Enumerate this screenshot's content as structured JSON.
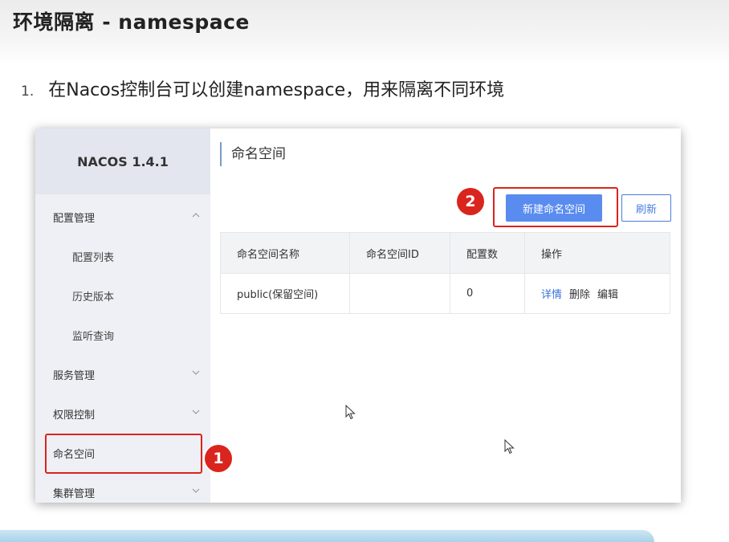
{
  "slide": {
    "title": "环境隔离 - namespace",
    "step_number": "1.",
    "step_text": "在Nacos控制台可以创建namespace，用来隔离不同环境"
  },
  "console": {
    "logo": "NACOS 1.4.1",
    "menu": [
      {
        "label": "配置管理",
        "chevron": "chevron-up-icon"
      },
      {
        "label": "配置列表"
      },
      {
        "label": "历史版本"
      },
      {
        "label": "监听查询"
      },
      {
        "label": "服务管理",
        "chevron": "chevron-down-icon"
      },
      {
        "label": "权限控制",
        "chevron": "chevron-down-icon"
      },
      {
        "label": "命名空间"
      },
      {
        "label": "集群管理",
        "chevron": "chevron-down-icon"
      }
    ],
    "page_title": "命名空间",
    "buttons": {
      "new_namespace": "新建命名空间",
      "refresh": "刷新"
    },
    "table": {
      "headers": [
        "命名空间名称",
        "命名空间ID",
        "配置数",
        "操作"
      ],
      "rows": [
        {
          "name": "public(保留空间)",
          "id": "",
          "count": "0",
          "actions": [
            "详情",
            "删除",
            "编辑"
          ]
        }
      ]
    }
  },
  "annotations": {
    "badge_1": "1",
    "badge_2": "2"
  },
  "colors": {
    "primary_button": "#5a8cf0",
    "link": "#3a72d8",
    "highlight_red": "#d9251d",
    "sidebar_bg": "#eef0f5"
  }
}
